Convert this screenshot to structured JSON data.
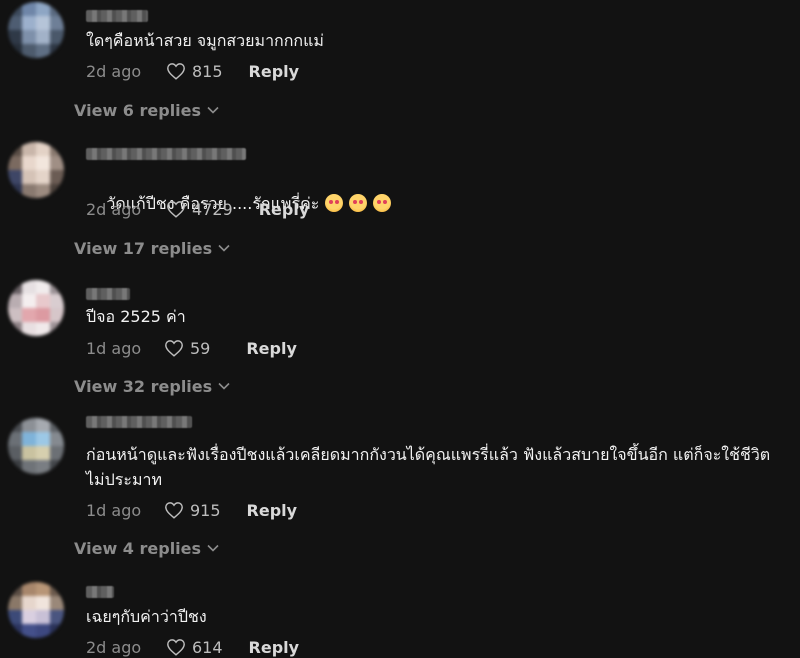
{
  "comments": [
    {
      "text": "ใดๆคือหน้าสวย จมูกสวยมากกกแม่",
      "time": "2d ago",
      "likes": "815",
      "reply_label": "Reply",
      "view_replies": "View 6 replies",
      "emojis": []
    },
    {
      "text": "วัดแก้ปีชง คือรวย ....รักแพรี่ค่ะ",
      "time": "2d ago",
      "likes": "4729",
      "reply_label": "Reply",
      "view_replies": "View 17 replies",
      "emojis": [
        "smiling-face-with-hearts-icon",
        "smiling-face-with-hearts-icon",
        "smiling-face-with-hearts-icon"
      ]
    },
    {
      "text": "ปีจอ 2525 ค่า",
      "time": "1d ago",
      "likes": "59",
      "reply_label": "Reply",
      "view_replies": "View 32 replies",
      "emojis": []
    },
    {
      "text": "ก่อนหน้าดูและฟังเรื่องปีชงแล้วเคลียดมากกังวนได้คุณแพรรี่แล้ว ฟังแล้วสบายใจขึ้นอีก แต่ก็จะใช้ชีวิตไม่ประมาท",
      "time": "1d ago",
      "likes": "915",
      "reply_label": "Reply",
      "view_replies": "View 4 replies",
      "emojis": []
    },
    {
      "text": "เฉยๆกับค่าว่าปีชง",
      "time": "2d ago",
      "likes": "614",
      "reply_label": "Reply",
      "view_replies": "",
      "emojis": []
    }
  ],
  "colors": {
    "background": "#121212",
    "text": "#f2f2f2",
    "muted": "#8c8c8c"
  }
}
